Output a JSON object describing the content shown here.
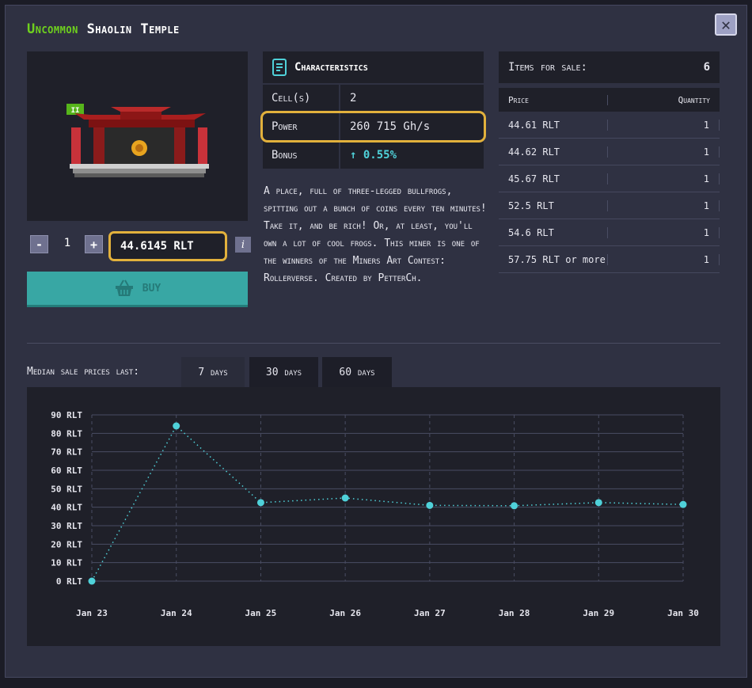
{
  "title": {
    "rarity": "Uncommon",
    "name": "Shaolin Temple"
  },
  "miner": {
    "level_badge": "II"
  },
  "purchase": {
    "quantity": "1",
    "minus_label": "-",
    "plus_label": "+",
    "price_value": "44.6145 RLT",
    "info_label": "i",
    "buy_label": "BUY"
  },
  "characteristics": {
    "heading": "Characteristics",
    "rows": [
      {
        "key": "Cell(s)",
        "value": "2"
      },
      {
        "key": "Power",
        "value": "260 715 Gh/s"
      },
      {
        "key": "Bonus",
        "value": "0.55%"
      }
    ],
    "description": "A place, full of three-legged bullfrogs, spitting out a bunch of coins every ten minutes! Take it, and be rich! Or, at least, you'll own a lot of cool frogs. This miner is one of the winners of the Miners Art Contest: Rollerverse. Created by PetterCh."
  },
  "sale": {
    "heading": "Items for sale:",
    "count": "6",
    "col_price": "Price",
    "col_quantity": "Quantity",
    "rows": [
      {
        "price": "44.61 RLT",
        "qty": "1"
      },
      {
        "price": "44.62 RLT",
        "qty": "1"
      },
      {
        "price": "45.67 RLT",
        "qty": "1"
      },
      {
        "price": "52.5 RLT",
        "qty": "1"
      },
      {
        "price": "54.6 RLT",
        "qty": "1"
      },
      {
        "price": "57.75 RLT or more",
        "qty": "1"
      }
    ]
  },
  "median": {
    "label": "Median sale prices last:",
    "tabs": [
      "7 days",
      "30 days",
      "60 days"
    ],
    "active_tab": 0
  },
  "colors": {
    "accent": "#e2b13c",
    "teal": "#38a7a4",
    "point": "#4fd1d9",
    "rarity": "#6fd11e"
  },
  "chart_data": {
    "type": "line",
    "x": [
      "Jan 23",
      "Jan 24",
      "Jan 25",
      "Jan 26",
      "Jan 27",
      "Jan 28",
      "Jan 29",
      "Jan 30"
    ],
    "series": [
      {
        "values": [
          0,
          84,
          42.5,
          45,
          41,
          40.8,
          42.5,
          41.5
        ]
      }
    ],
    "yticks": [
      "90 RLT",
      "80 RLT",
      "70 RLT",
      "60 RLT",
      "50 RLT",
      "40 RLT",
      "30 RLT",
      "20 RLT",
      "10 RLT",
      "0 RLT"
    ],
    "ylim": [
      0,
      90
    ],
    "grid": true
  }
}
